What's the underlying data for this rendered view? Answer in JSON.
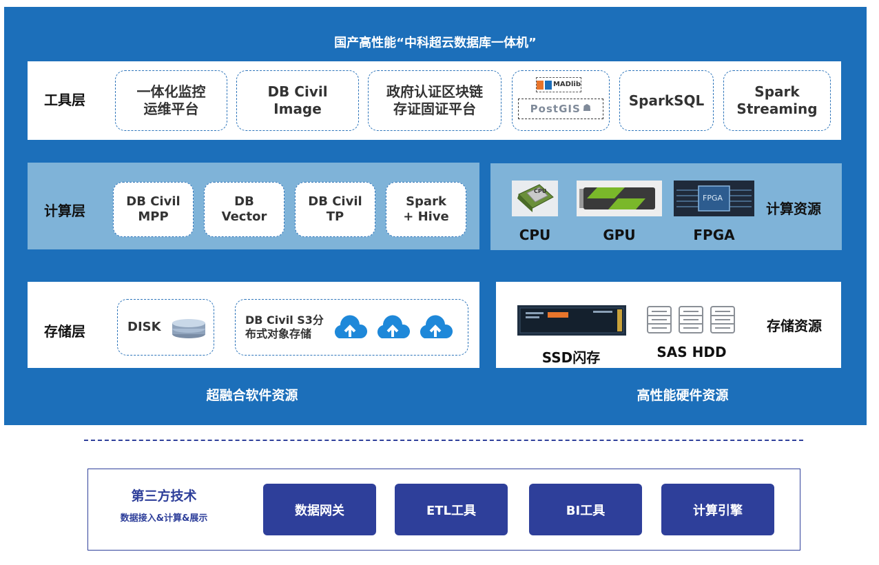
{
  "title": "国产高性能“中科超云数据库一体机”",
  "tool_layer": {
    "label": "工具层",
    "items": [
      "一体化监控\n运维平台",
      "DB Civil\nImage",
      "政府认证区块链\n存证固证平台",
      "SparkSQL",
      "Spark\nStreaming"
    ],
    "logos": [
      "MADlib",
      "PostGIS"
    ]
  },
  "compute_layer": {
    "label": "计算层",
    "items": [
      "DB Civil\nMPP",
      "DB\nVector",
      "DB Civil\nTP",
      "Spark\n+ Hive"
    ]
  },
  "compute_resources": {
    "label": "计算资源",
    "items": [
      "CPU",
      "GPU",
      "FPGA"
    ],
    "chip_texts": [
      "CPU",
      "FPGA"
    ]
  },
  "storage_layer": {
    "label": "存储层",
    "disk": "DISK",
    "s3": "DB Civil S3分\n布式对象存储"
  },
  "storage_resources": {
    "label": "存储资源",
    "items": [
      "SSD闪存",
      "SAS HDD"
    ]
  },
  "footer": {
    "software": "超融合软件资源",
    "hardware": "高性能硬件资源"
  },
  "third_party": {
    "title": "第三方技术",
    "subtitle": "数据接入&计算&展示",
    "buttons": [
      "数据网关",
      "ETL工具",
      "BI工具",
      "计算引擎"
    ]
  },
  "colors": {
    "panel": "#1c6fba",
    "band_light": "#7fb3d8",
    "navy": "#2e3f9a",
    "dash": "#2b73b9"
  }
}
